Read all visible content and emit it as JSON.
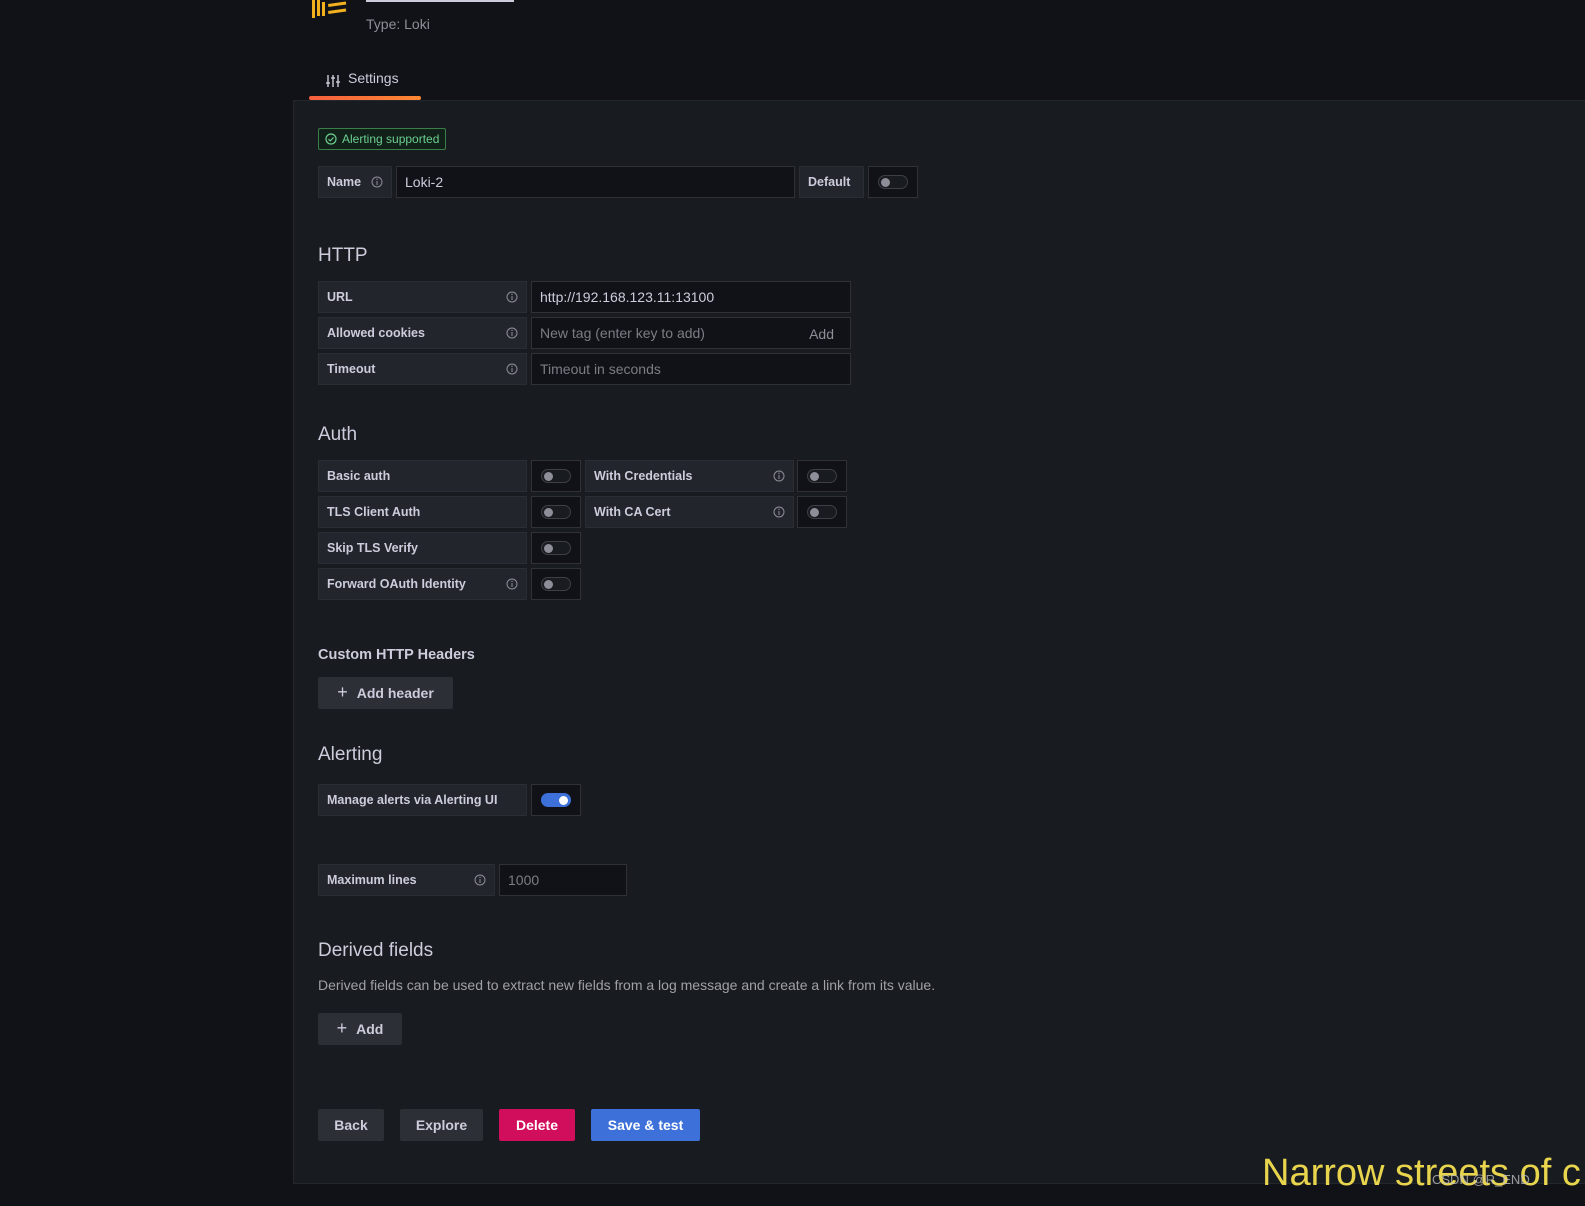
{
  "header": {
    "type_label": "Type: Loki",
    "tab_settings": "Settings"
  },
  "badge": {
    "alerting_supported": "Alerting supported"
  },
  "name_row": {
    "name_label": "Name",
    "name_value": "Loki-2",
    "default_label": "Default",
    "default_on": false
  },
  "http": {
    "title": "HTTP",
    "url_label": "URL",
    "url_value": "http://192.168.123.11:13100",
    "cookies_label": "Allowed cookies",
    "cookies_placeholder": "New tag (enter key to add)",
    "cookies_add": "Add",
    "timeout_label": "Timeout",
    "timeout_placeholder": "Timeout in seconds"
  },
  "auth": {
    "title": "Auth",
    "basic_auth": "Basic auth",
    "with_credentials": "With Credentials",
    "tls_client_auth": "TLS Client Auth",
    "with_ca_cert": "With CA Cert",
    "skip_tls_verify": "Skip TLS Verify",
    "forward_oauth": "Forward OAuth Identity"
  },
  "custom_headers": {
    "title": "Custom HTTP Headers",
    "add_button": "Add header"
  },
  "alerting": {
    "title": "Alerting",
    "manage_label": "Manage alerts via Alerting UI",
    "manage_on": true
  },
  "max_lines": {
    "label": "Maximum lines",
    "placeholder": "1000"
  },
  "derived": {
    "title": "Derived fields",
    "description": "Derived fields can be used to extract new fields from a log message and create a link from its value.",
    "add_button": "Add"
  },
  "footer": {
    "back": "Back",
    "explore": "Explore",
    "delete": "Delete",
    "save_test": "Save & test"
  },
  "watermark": {
    "main": "Narrow streets of c",
    "small": "CSDN @R_END"
  },
  "colors": {
    "background": "#111217",
    "panel": "#181b1f",
    "primary": "#3d71d9",
    "danger": "#d10e5c",
    "success": "#6ccf8e",
    "tab_accent": "#f55f3e"
  },
  "icons": [
    "loki-logo-icon",
    "sliders-icon",
    "check-circle-icon",
    "info-icon",
    "plus-icon"
  ]
}
